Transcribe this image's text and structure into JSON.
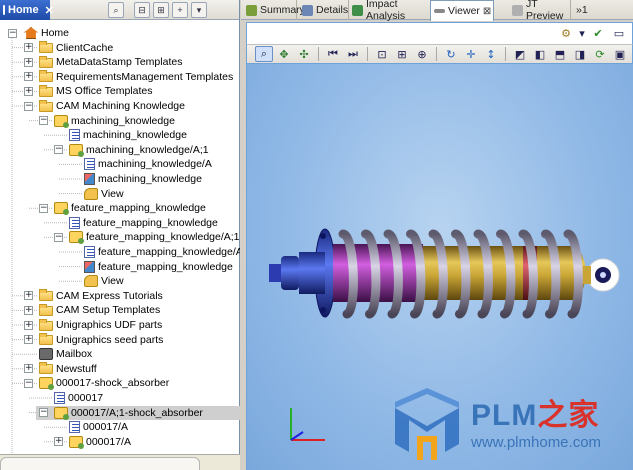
{
  "left_panel": {
    "home_tab_label": "Home",
    "close_glyph": "✕",
    "toolbar_icons": [
      "search-icon",
      "collapse-icon",
      "expand-icon",
      "add-icon",
      "menu-icon"
    ],
    "tree": [
      {
        "label": "Home",
        "icon": "home-icon",
        "expander": "minus"
      },
      {
        "label": "ClientCache",
        "icon": "folder-icon",
        "expander": "plus"
      },
      {
        "label": "MetaDataStamp Templates",
        "icon": "folder-icon",
        "expander": "plus"
      },
      {
        "label": "RequirementsManagement Templates",
        "icon": "folder-icon",
        "expander": "plus"
      },
      {
        "label": "MS Office Templates",
        "icon": "folder-icon",
        "expander": "plus"
      },
      {
        "label": "CAM Machining Knowledge",
        "icon": "folder-icon",
        "expander": "minus"
      },
      {
        "label": "machining_knowledge",
        "icon": "item-icon",
        "expander": "minus"
      },
      {
        "label": "machining_knowledge",
        "icon": "document-icon",
        "expander": ""
      },
      {
        "label": "machining_knowledge/A;1",
        "icon": "item-revision-icon",
        "expander": "minus"
      },
      {
        "label": "machining_knowledge/A",
        "icon": "document-icon",
        "expander": ""
      },
      {
        "label": "machining_knowledge",
        "icon": "dataset-icon",
        "expander": ""
      },
      {
        "label": "View",
        "icon": "view-icon",
        "expander": ""
      },
      {
        "label": "feature_mapping_knowledge",
        "icon": "item-icon",
        "expander": "minus"
      },
      {
        "label": "feature_mapping_knowledge",
        "icon": "document-icon",
        "expander": ""
      },
      {
        "label": "feature_mapping_knowledge/A;1",
        "icon": "item-revision-icon",
        "expander": "minus"
      },
      {
        "label": "feature_mapping_knowledge/A",
        "icon": "document-icon",
        "expander": ""
      },
      {
        "label": "feature_mapping_knowledge",
        "icon": "dataset-icon",
        "expander": ""
      },
      {
        "label": "View",
        "icon": "view-icon",
        "expander": ""
      },
      {
        "label": "CAM Express Tutorials",
        "icon": "folder-icon",
        "expander": "plus"
      },
      {
        "label": "CAM Setup Templates",
        "icon": "folder-icon",
        "expander": "plus"
      },
      {
        "label": "Unigraphics UDF parts",
        "icon": "folder-icon",
        "expander": "plus"
      },
      {
        "label": "Unigraphics seed parts",
        "icon": "folder-icon",
        "expander": "plus"
      },
      {
        "label": "Mailbox",
        "icon": "mailbox-icon",
        "expander": ""
      },
      {
        "label": "Newstuff",
        "icon": "folder-icon",
        "expander": "plus"
      },
      {
        "label": "000017-shock_absorber",
        "icon": "item-icon",
        "expander": "minus"
      },
      {
        "label": "000017",
        "icon": "document-icon",
        "expander": ""
      },
      {
        "label": "000017/A;1-shock_absorber",
        "icon": "item-revision-icon",
        "expander": "minus",
        "selected": true
      },
      {
        "label": "000017/A",
        "icon": "document-icon",
        "expander": ""
      },
      {
        "label": "000017/A",
        "icon": "bom-icon",
        "expander": "plus"
      }
    ]
  },
  "right_panel": {
    "tabs": [
      {
        "label": "Summary",
        "icon": "summary-icon"
      },
      {
        "label": "Details",
        "icon": "details-icon"
      },
      {
        "label": "Impact Analysis",
        "icon": "impact-analysis-icon"
      },
      {
        "label": "Viewer",
        "icon": "viewer-icon",
        "active": true
      },
      {
        "label": "JT Preview",
        "icon": "jt-preview-icon"
      },
      {
        "label": "»1",
        "icon": ""
      }
    ],
    "viewer_toolbar": [
      "select-icon",
      "pan-icon",
      "rotate-icon",
      "first-icon",
      "last-icon",
      "fit-icon",
      "zoom-window-icon",
      "zoom-in-icon",
      "zoom-out-icon",
      "spin-icon",
      "move-icon",
      "vertical-move-icon",
      "iso-view-icon",
      "front-view-icon",
      "top-view-icon",
      "side-view-icon",
      "refresh-icon",
      "image-icon"
    ]
  },
  "watermark": {
    "brand_prefix": "PLM",
    "brand_suffix": "之家",
    "url": "www.plmhome.com"
  },
  "colors": {
    "viewport_bg": "#8fb8e6",
    "spring": "#9a8fb0",
    "cylinder_gold": "#b8962a",
    "cylinder_purple": "#9a3aa8",
    "cylinder_red": "#b8353f",
    "flange_blue": "#3347c7",
    "selected_row": "#cfcfcf",
    "active_tab_blue": "#2d5cc5"
  }
}
